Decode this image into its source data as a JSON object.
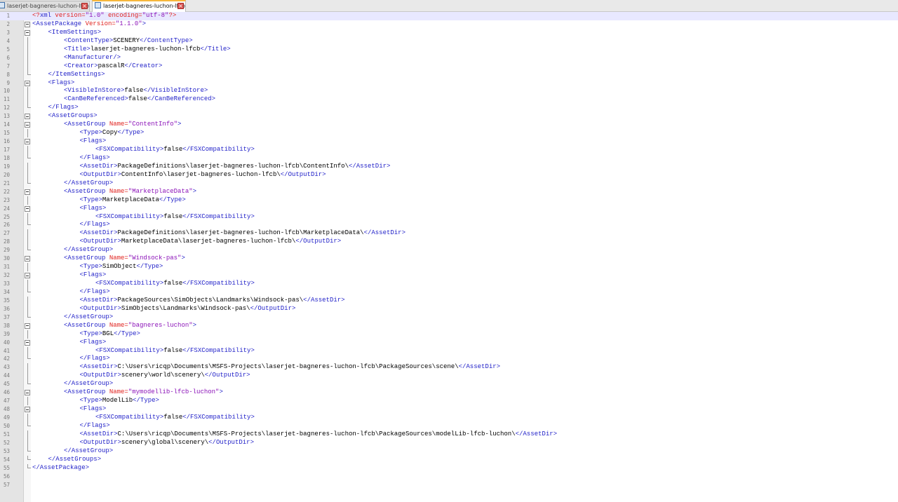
{
  "tabs": [
    {
      "label": "laserjet-bagneres-luchon-lfcb.xml",
      "active": false
    },
    {
      "label": "laserjet-bagneres-luchon-lfcb.xml",
      "active": true
    }
  ],
  "colors": {
    "tag": "#1f1fc8",
    "attr": "#e0221e",
    "value": "#8b12b8",
    "text": "#000000",
    "current_line": "#e8e8ff",
    "tab_accent": "#f6b73c"
  },
  "lines": [
    {
      "n": "1",
      "indent": 0,
      "fold": "none",
      "tokens": [
        [
          "pi",
          "<?"
        ],
        [
          "tag",
          "xml"
        ],
        [
          "attr",
          " version="
        ],
        [
          "val",
          "\"1.0\""
        ],
        [
          "attr",
          " encoding="
        ],
        [
          "val",
          "\"utf-8\""
        ],
        [
          "pi",
          "?>"
        ]
      ]
    },
    {
      "n": "2",
      "indent": 0,
      "fold": "box",
      "tokens": [
        [
          "tag",
          "<AssetPackage"
        ],
        [
          "attr",
          " Version="
        ],
        [
          "val",
          "\"1.1.0\""
        ],
        [
          "tag",
          ">"
        ]
      ]
    },
    {
      "n": "3",
      "indent": 1,
      "fold": "box",
      "tokens": [
        [
          "tag",
          "<ItemSettings>"
        ]
      ]
    },
    {
      "n": "4",
      "indent": 2,
      "fold": "line",
      "tokens": [
        [
          "tag",
          "<ContentType>"
        ],
        [
          "text",
          "SCENERY"
        ],
        [
          "tag",
          "</ContentType>"
        ]
      ]
    },
    {
      "n": "5",
      "indent": 2,
      "fold": "line",
      "tokens": [
        [
          "tag",
          "<Title>"
        ],
        [
          "text",
          "laserjet-bagneres-luchon-lfcb"
        ],
        [
          "tag",
          "</Title>"
        ]
      ]
    },
    {
      "n": "6",
      "indent": 2,
      "fold": "line",
      "tokens": [
        [
          "tag",
          "<Manufacturer/>"
        ]
      ]
    },
    {
      "n": "7",
      "indent": 2,
      "fold": "line",
      "tokens": [
        [
          "tag",
          "<Creator>"
        ],
        [
          "text",
          "pascalR"
        ],
        [
          "tag",
          "</Creator>"
        ]
      ]
    },
    {
      "n": "8",
      "indent": 1,
      "fold": "end",
      "tokens": [
        [
          "tag",
          "</ItemSettings>"
        ]
      ]
    },
    {
      "n": "9",
      "indent": 1,
      "fold": "box",
      "tokens": [
        [
          "tag",
          "<Flags>"
        ]
      ]
    },
    {
      "n": "10",
      "indent": 2,
      "fold": "line",
      "tokens": [
        [
          "tag",
          "<VisibleInStore>"
        ],
        [
          "text",
          "false"
        ],
        [
          "tag",
          "</VisibleInStore>"
        ]
      ]
    },
    {
      "n": "11",
      "indent": 2,
      "fold": "line",
      "tokens": [
        [
          "tag",
          "<CanBeReferenced>"
        ],
        [
          "text",
          "false"
        ],
        [
          "tag",
          "</CanBeReferenced>"
        ]
      ]
    },
    {
      "n": "12",
      "indent": 1,
      "fold": "end",
      "tokens": [
        [
          "tag",
          "</Flags>"
        ]
      ]
    },
    {
      "n": "13",
      "indent": 1,
      "fold": "box",
      "tokens": [
        [
          "tag",
          "<AssetGroups>"
        ]
      ]
    },
    {
      "n": "14",
      "indent": 2,
      "fold": "box",
      "tokens": [
        [
          "tag",
          "<AssetGroup"
        ],
        [
          "attr",
          " Name="
        ],
        [
          "val",
          "\"ContentInfo\""
        ],
        [
          "tag",
          ">"
        ]
      ]
    },
    {
      "n": "15",
      "indent": 3,
      "fold": "line",
      "tokens": [
        [
          "tag",
          "<Type>"
        ],
        [
          "text",
          "Copy"
        ],
        [
          "tag",
          "</Type>"
        ]
      ]
    },
    {
      "n": "16",
      "indent": 3,
      "fold": "box",
      "tokens": [
        [
          "tag",
          "<Flags>"
        ]
      ]
    },
    {
      "n": "17",
      "indent": 4,
      "fold": "line",
      "tokens": [
        [
          "tag",
          "<FSXCompatibility>"
        ],
        [
          "text",
          "false"
        ],
        [
          "tag",
          "</FSXCompatibility>"
        ]
      ]
    },
    {
      "n": "18",
      "indent": 3,
      "fold": "end",
      "tokens": [
        [
          "tag",
          "</Flags>"
        ]
      ]
    },
    {
      "n": "19",
      "indent": 3,
      "fold": "line",
      "tokens": [
        [
          "tag",
          "<AssetDir>"
        ],
        [
          "text",
          "PackageDefinitions\\laserjet-bagneres-luchon-lfcb\\ContentInfo\\"
        ],
        [
          "tag",
          "</AssetDir>"
        ]
      ]
    },
    {
      "n": "20",
      "indent": 3,
      "fold": "line",
      "tokens": [
        [
          "tag",
          "<OutputDir>"
        ],
        [
          "text",
          "ContentInfo\\laserjet-bagneres-luchon-lfcb\\"
        ],
        [
          "tag",
          "</OutputDir>"
        ]
      ]
    },
    {
      "n": "21",
      "indent": 2,
      "fold": "end",
      "tokens": [
        [
          "tag",
          "</AssetGroup>"
        ]
      ]
    },
    {
      "n": "22",
      "indent": 2,
      "fold": "box",
      "tokens": [
        [
          "tag",
          "<AssetGroup"
        ],
        [
          "attr",
          " Name="
        ],
        [
          "val",
          "\"MarketplaceData\""
        ],
        [
          "tag",
          ">"
        ]
      ]
    },
    {
      "n": "23",
      "indent": 3,
      "fold": "line",
      "tokens": [
        [
          "tag",
          "<Type>"
        ],
        [
          "text",
          "MarketplaceData"
        ],
        [
          "tag",
          "</Type>"
        ]
      ]
    },
    {
      "n": "24",
      "indent": 3,
      "fold": "box",
      "tokens": [
        [
          "tag",
          "<Flags>"
        ]
      ]
    },
    {
      "n": "25",
      "indent": 4,
      "fold": "line",
      "tokens": [
        [
          "tag",
          "<FSXCompatibility>"
        ],
        [
          "text",
          "false"
        ],
        [
          "tag",
          "</FSXCompatibility>"
        ]
      ]
    },
    {
      "n": "26",
      "indent": 3,
      "fold": "end",
      "tokens": [
        [
          "tag",
          "</Flags>"
        ]
      ]
    },
    {
      "n": "27",
      "indent": 3,
      "fold": "line",
      "tokens": [
        [
          "tag",
          "<AssetDir>"
        ],
        [
          "text",
          "PackageDefinitions\\laserjet-bagneres-luchon-lfcb\\MarketplaceData\\"
        ],
        [
          "tag",
          "</AssetDir>"
        ]
      ]
    },
    {
      "n": "28",
      "indent": 3,
      "fold": "line",
      "tokens": [
        [
          "tag",
          "<OutputDir>"
        ],
        [
          "text",
          "MarketplaceData\\laserjet-bagneres-luchon-lfcb\\"
        ],
        [
          "tag",
          "</OutputDir>"
        ]
      ]
    },
    {
      "n": "29",
      "indent": 2,
      "fold": "end",
      "tokens": [
        [
          "tag",
          "</AssetGroup>"
        ]
      ]
    },
    {
      "n": "30",
      "indent": 2,
      "fold": "box",
      "tokens": [
        [
          "tag",
          "<AssetGroup"
        ],
        [
          "attr",
          " Name="
        ],
        [
          "val",
          "\"Windsock-pas\""
        ],
        [
          "tag",
          ">"
        ]
      ]
    },
    {
      "n": "31",
      "indent": 3,
      "fold": "line",
      "tokens": [
        [
          "tag",
          "<Type>"
        ],
        [
          "text",
          "SimObject"
        ],
        [
          "tag",
          "</Type>"
        ]
      ]
    },
    {
      "n": "32",
      "indent": 3,
      "fold": "box",
      "tokens": [
        [
          "tag",
          "<Flags>"
        ]
      ]
    },
    {
      "n": "33",
      "indent": 4,
      "fold": "line",
      "tokens": [
        [
          "tag",
          "<FSXCompatibility>"
        ],
        [
          "text",
          "false"
        ],
        [
          "tag",
          "</FSXCompatibility>"
        ]
      ]
    },
    {
      "n": "34",
      "indent": 3,
      "fold": "end",
      "tokens": [
        [
          "tag",
          "</Flags>"
        ]
      ]
    },
    {
      "n": "35",
      "indent": 3,
      "fold": "line",
      "tokens": [
        [
          "tag",
          "<AssetDir>"
        ],
        [
          "text",
          "PackageSources\\SimObjects\\Landmarks\\Windsock-pas\\"
        ],
        [
          "tag",
          "</AssetDir>"
        ]
      ]
    },
    {
      "n": "36",
      "indent": 3,
      "fold": "line",
      "tokens": [
        [
          "tag",
          "<OutputDir>"
        ],
        [
          "text",
          "SimObjects\\Landmarks\\Windsock-pas\\"
        ],
        [
          "tag",
          "</OutputDir>"
        ]
      ]
    },
    {
      "n": "37",
      "indent": 2,
      "fold": "end",
      "tokens": [
        [
          "tag",
          "</AssetGroup>"
        ]
      ]
    },
    {
      "n": "38",
      "indent": 2,
      "fold": "box",
      "tokens": [
        [
          "tag",
          "<AssetGroup"
        ],
        [
          "attr",
          " Name="
        ],
        [
          "val",
          "\"bagneres-luchon\""
        ],
        [
          "tag",
          ">"
        ]
      ]
    },
    {
      "n": "39",
      "indent": 3,
      "fold": "line",
      "tokens": [
        [
          "tag",
          "<Type>"
        ],
        [
          "text",
          "BGL"
        ],
        [
          "tag",
          "</Type>"
        ]
      ]
    },
    {
      "n": "40",
      "indent": 3,
      "fold": "box",
      "tokens": [
        [
          "tag",
          "<Flags>"
        ]
      ]
    },
    {
      "n": "41",
      "indent": 4,
      "fold": "line",
      "tokens": [
        [
          "tag",
          "<FSXCompatibility>"
        ],
        [
          "text",
          "false"
        ],
        [
          "tag",
          "</FSXCompatibility>"
        ]
      ]
    },
    {
      "n": "42",
      "indent": 3,
      "fold": "end",
      "tokens": [
        [
          "tag",
          "</Flags>"
        ]
      ]
    },
    {
      "n": "43",
      "indent": 3,
      "fold": "line",
      "tokens": [
        [
          "tag",
          "<AssetDir>"
        ],
        [
          "text",
          "C:\\Users\\ricqp\\Documents\\MSFS-Projects\\laserjet-bagneres-luchon-lfcb\\PackageSources\\scene\\"
        ],
        [
          "tag",
          "</AssetDir>"
        ]
      ]
    },
    {
      "n": "44",
      "indent": 3,
      "fold": "line",
      "tokens": [
        [
          "tag",
          "<OutputDir>"
        ],
        [
          "text",
          "scenery\\world\\scenery\\"
        ],
        [
          "tag",
          "</OutputDir>"
        ]
      ]
    },
    {
      "n": "45",
      "indent": 2,
      "fold": "end",
      "tokens": [
        [
          "tag",
          "</AssetGroup>"
        ]
      ]
    },
    {
      "n": "46",
      "indent": 2,
      "fold": "box",
      "tokens": [
        [
          "tag",
          "<AssetGroup"
        ],
        [
          "attr",
          " Name="
        ],
        [
          "val",
          "\"mymodellib-lfcb-luchon\""
        ],
        [
          "tag",
          ">"
        ]
      ]
    },
    {
      "n": "47",
      "indent": 3,
      "fold": "line",
      "tokens": [
        [
          "tag",
          "<Type>"
        ],
        [
          "text",
          "ModelLib"
        ],
        [
          "tag",
          "</Type>"
        ]
      ]
    },
    {
      "n": "48",
      "indent": 3,
      "fold": "box",
      "tokens": [
        [
          "tag",
          "<Flags>"
        ]
      ]
    },
    {
      "n": "49",
      "indent": 4,
      "fold": "line",
      "tokens": [
        [
          "tag",
          "<FSXCompatibility>"
        ],
        [
          "text",
          "false"
        ],
        [
          "tag",
          "</FSXCompatibility>"
        ]
      ]
    },
    {
      "n": "50",
      "indent": 3,
      "fold": "end",
      "tokens": [
        [
          "tag",
          "</Flags>"
        ]
      ]
    },
    {
      "n": "51",
      "indent": 3,
      "fold": "line",
      "tokens": [
        [
          "tag",
          "<AssetDir>"
        ],
        [
          "text",
          "C:\\Users\\ricqp\\Documents\\MSFS-Projects\\laserjet-bagneres-luchon-lfcb\\PackageSources\\modelLib-lfcb-luchon\\"
        ],
        [
          "tag",
          "</AssetDir>"
        ]
      ]
    },
    {
      "n": "52",
      "indent": 3,
      "fold": "line",
      "tokens": [
        [
          "tag",
          "<OutputDir>"
        ],
        [
          "text",
          "scenery\\global\\scenery\\"
        ],
        [
          "tag",
          "</OutputDir>"
        ]
      ]
    },
    {
      "n": "53",
      "indent": 2,
      "fold": "end",
      "tokens": [
        [
          "tag",
          "</AssetGroup>"
        ]
      ]
    },
    {
      "n": "54",
      "indent": 1,
      "fold": "end",
      "tokens": [
        [
          "tag",
          "</AssetGroups>"
        ]
      ]
    },
    {
      "n": "55",
      "indent": 0,
      "fold": "end",
      "tokens": [
        [
          "tag",
          "</AssetPackage>"
        ]
      ]
    },
    {
      "n": "56",
      "indent": 0,
      "fold": "none",
      "tokens": []
    },
    {
      "n": "57",
      "indent": 0,
      "fold": "none",
      "tokens": []
    }
  ]
}
